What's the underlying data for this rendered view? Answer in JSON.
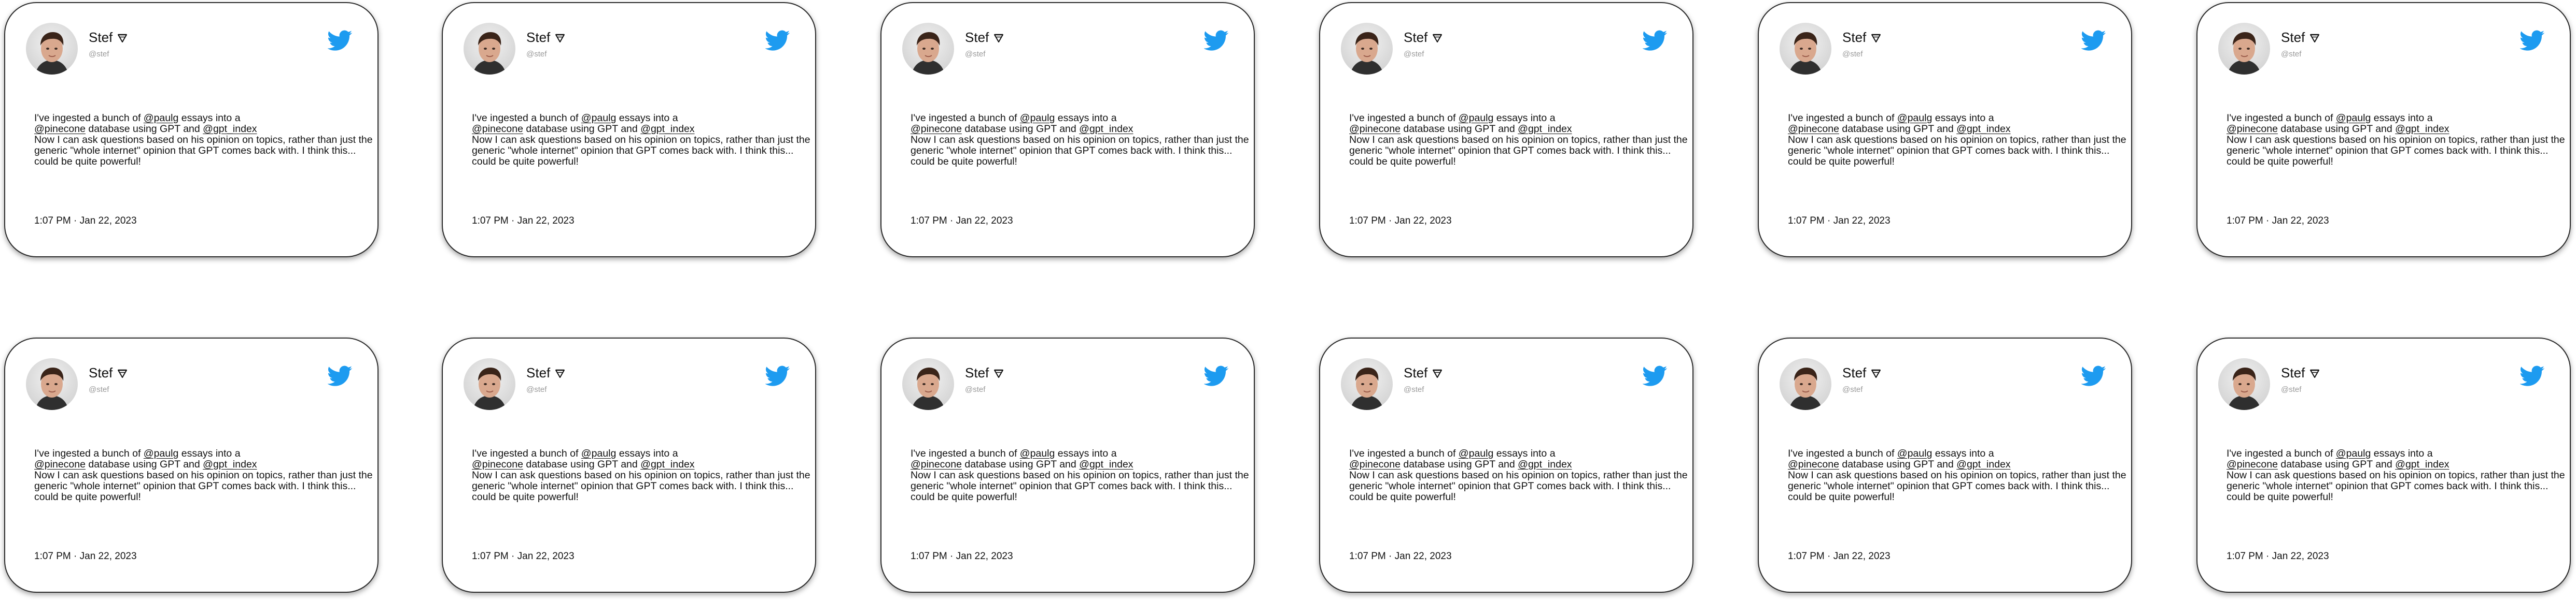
{
  "tweet": {
    "name": "Stef",
    "name_icon": "triangle-flag-icon",
    "handle": "@stef",
    "brand_icon": "twitter-bird-icon",
    "brand_color": "#1d9bf0",
    "line1_pre": "I've ingested a bunch of ",
    "mention_paulg": "@paulg",
    "line1_post": " essays into a",
    "mention_pinecone": "@pinecone",
    "line2_mid": " database using GPT and ",
    "mention_gpt_index": "@gpt_index",
    "line3": "Now I can ask questions based on his opinion on topics, rather than just the",
    "line4": "generic \"whole internet\" opinion that GPT comes back with. I think this...",
    "line5": "could be quite powerful!",
    "timestamp": "1:07 PM · Jan 22, 2023"
  },
  "grid": {
    "rows": 2,
    "columns": 6
  }
}
